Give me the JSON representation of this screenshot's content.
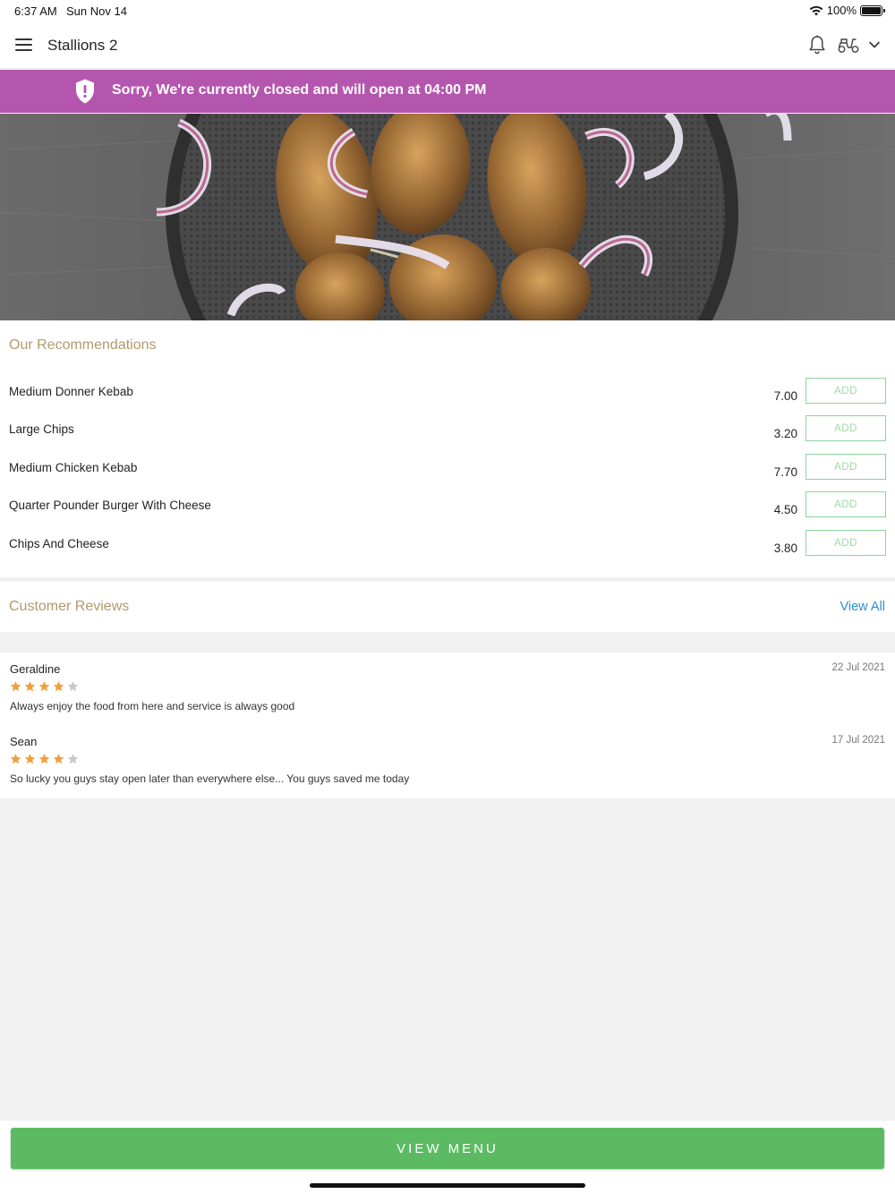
{
  "status_bar": {
    "time": "6:37 AM",
    "date": "Sun Nov 14",
    "battery": "100%"
  },
  "header": {
    "store_name": "Stallions 2",
    "icons": [
      "menu-icon",
      "bell-icon",
      "scooter-icon",
      "chevron-down-icon"
    ]
  },
  "banner": {
    "message": "Sorry, We're currently closed and will open at 04:00 PM",
    "color": "#b556ae",
    "icon": "shield-alert-icon"
  },
  "recommendations": {
    "title": "Our Recommendations",
    "add_label": "ADD",
    "items": [
      {
        "name": "Medium Donner Kebab",
        "price": "7.00"
      },
      {
        "name": "Large Chips",
        "price": "3.20"
      },
      {
        "name": "Medium Chicken Kebab",
        "price": "7.70"
      },
      {
        "name": "Quarter Pounder Burger With Cheese",
        "price": "4.50"
      },
      {
        "name": "Chips And Cheese",
        "price": "3.80"
      }
    ]
  },
  "reviews": {
    "title": "Customer Reviews",
    "view_all": "View All",
    "items": [
      {
        "author": "Geraldine",
        "date": "22 Jul 2021",
        "rating": 4,
        "max_rating": 5,
        "text": "Always enjoy the food from here and service is always good"
      },
      {
        "author": "Sean",
        "date": "17 Jul 2021",
        "rating": 4,
        "max_rating": 5,
        "text": "So lucky you guys stay open later than everywhere else... You guys saved me today"
      }
    ]
  },
  "footer": {
    "view_menu": "VIEW MENU",
    "button_color": "#5cba63"
  },
  "colors": {
    "section_title": "#b19a6f",
    "link": "#2f8fd1",
    "star_on": "#f0a03c",
    "star_off": "#c8c8c8"
  }
}
